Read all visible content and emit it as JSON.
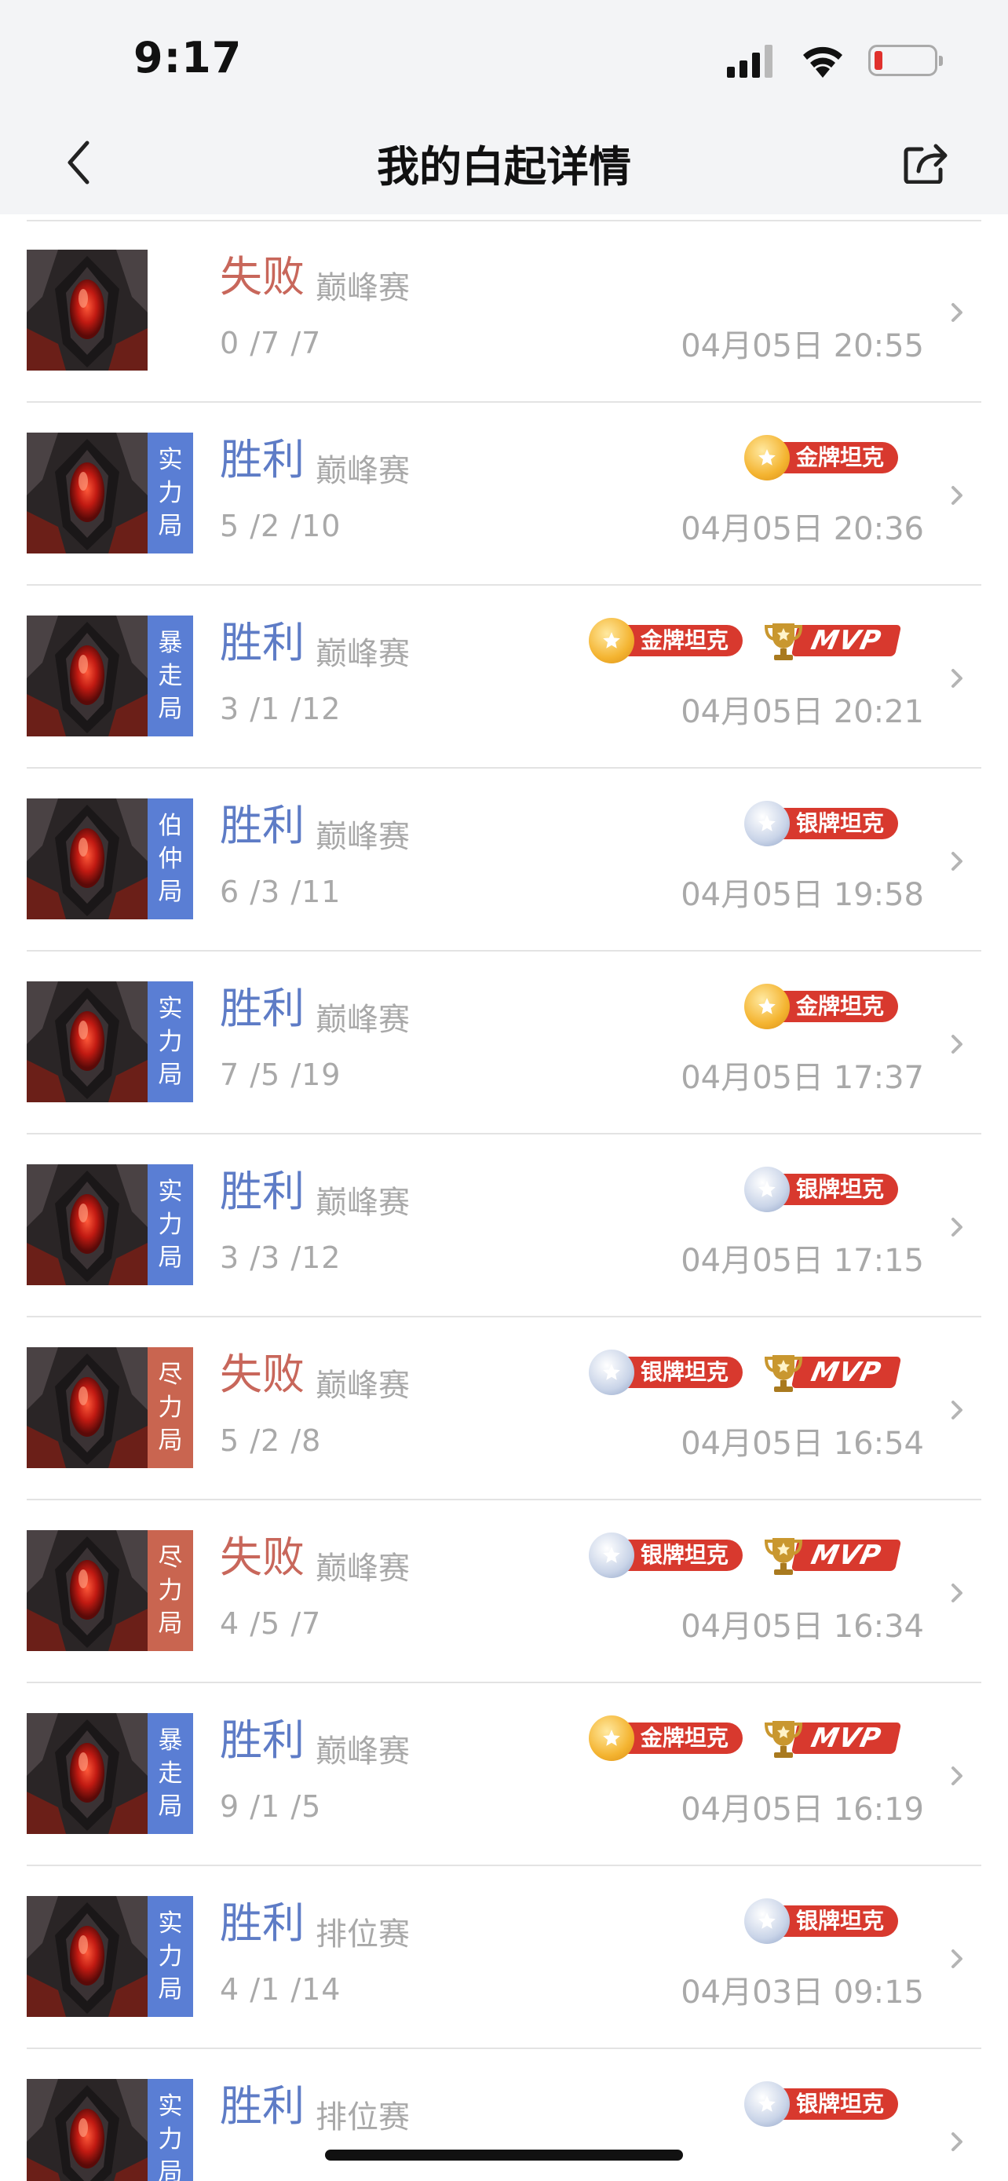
{
  "status_bar": {
    "time": "9:17"
  },
  "nav": {
    "title": "我的白起详情"
  },
  "colors": {
    "win": "#5e7cc6",
    "lose": "#c8675b",
    "tag_blue": "#5a7ed4",
    "tag_red": "#c96550",
    "badge_red": "#d8392e"
  },
  "badge_labels": {
    "gold_tank": "金牌坦克",
    "silver_tank": "银牌坦克",
    "mvp": "MVP"
  },
  "matches": [
    {
      "result": "失败",
      "outcome": "lose",
      "mode": "",
      "mode_color": "",
      "type": "巅峰赛",
      "kda": "0 /7 /7",
      "datetime": "04月05日 20:55",
      "badges": []
    },
    {
      "result": "胜利",
      "outcome": "win",
      "mode": "实力局",
      "mode_color": "blue",
      "type": "巅峰赛",
      "kda": "5 /2 /10",
      "datetime": "04月05日 20:36",
      "badges": [
        "gold_tank"
      ]
    },
    {
      "result": "胜利",
      "outcome": "win",
      "mode": "暴走局",
      "mode_color": "blue",
      "type": "巅峰赛",
      "kda": "3 /1 /12",
      "datetime": "04月05日 20:21",
      "badges": [
        "gold_tank",
        "mvp"
      ]
    },
    {
      "result": "胜利",
      "outcome": "win",
      "mode": "伯仲局",
      "mode_color": "blue",
      "type": "巅峰赛",
      "kda": "6 /3 /11",
      "datetime": "04月05日 19:58",
      "badges": [
        "silver_tank"
      ]
    },
    {
      "result": "胜利",
      "outcome": "win",
      "mode": "实力局",
      "mode_color": "blue",
      "type": "巅峰赛",
      "kda": "7 /5 /19",
      "datetime": "04月05日 17:37",
      "badges": [
        "gold_tank"
      ]
    },
    {
      "result": "胜利",
      "outcome": "win",
      "mode": "实力局",
      "mode_color": "blue",
      "type": "巅峰赛",
      "kda": "3 /3 /12",
      "datetime": "04月05日 17:15",
      "badges": [
        "silver_tank"
      ]
    },
    {
      "result": "失败",
      "outcome": "lose",
      "mode": "尽力局",
      "mode_color": "red",
      "type": "巅峰赛",
      "kda": "5 /2 /8",
      "datetime": "04月05日 16:54",
      "badges": [
        "silver_tank",
        "mvp"
      ]
    },
    {
      "result": "失败",
      "outcome": "lose",
      "mode": "尽力局",
      "mode_color": "red",
      "type": "巅峰赛",
      "kda": "4 /5 /7",
      "datetime": "04月05日 16:34",
      "badges": [
        "silver_tank",
        "mvp"
      ]
    },
    {
      "result": "胜利",
      "outcome": "win",
      "mode": "暴走局",
      "mode_color": "blue",
      "type": "巅峰赛",
      "kda": "9 /1 /5",
      "datetime": "04月05日 16:19",
      "badges": [
        "gold_tank",
        "mvp"
      ]
    },
    {
      "result": "胜利",
      "outcome": "win",
      "mode": "实力局",
      "mode_color": "blue",
      "type": "排位赛",
      "kda": "4 /1 /14",
      "datetime": "04月03日 09:15",
      "badges": [
        "silver_tank"
      ]
    },
    {
      "result": "胜利",
      "outcome": "win",
      "mode": "实力局",
      "mode_color": "blue",
      "type": "排位赛",
      "kda": "",
      "datetime": "",
      "badges": [
        "silver_tank"
      ]
    }
  ]
}
